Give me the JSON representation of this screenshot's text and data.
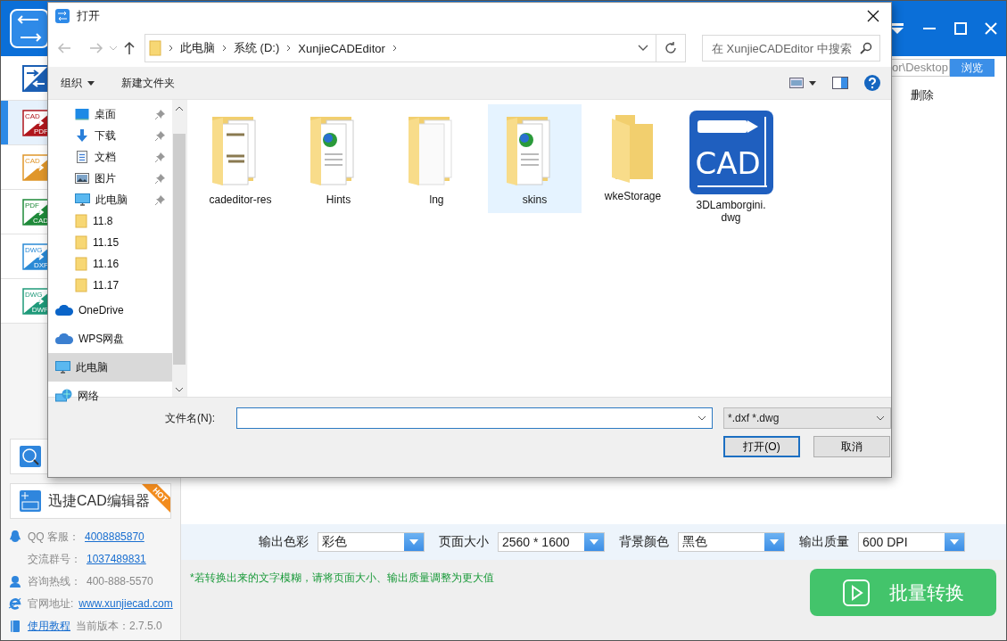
{
  "app": {
    "sidebar": {
      "tools": [
        {
          "kind": "convert",
          "selected": false
        },
        {
          "kind": "cad-pdf",
          "from": "CAD",
          "to": "PDF",
          "selected": true
        },
        {
          "kind": "cad-img",
          "from": "CAD",
          "selected": false
        },
        {
          "kind": "pdf-cad",
          "from": "PDF",
          "to": "CAD",
          "selected": false
        },
        {
          "kind": "dwg-dxf",
          "from": "DWG",
          "to": "DXF",
          "selected": false
        },
        {
          "kind": "dwg-dwf",
          "from": "DWG",
          "to": "DWF",
          "selected": false
        }
      ],
      "editor_button": {
        "label": "迅捷CAD编辑器",
        "badge": "HOT"
      },
      "contacts": [
        {
          "kind": "qq",
          "parts": [
            {
              "text": "QQ 客服：",
              "link": false
            },
            {
              "text": "4008885870",
              "link": true
            }
          ]
        },
        {
          "kind": "group",
          "parts": [
            {
              "text": "交流群号：",
              "link": false
            },
            {
              "text": "1037489831",
              "link": true
            }
          ]
        },
        {
          "kind": "hotline",
          "parts": [
            {
              "text": "咨询热线：",
              "link": false
            },
            {
              "text": "400-888-5570",
              "link": false
            }
          ]
        },
        {
          "kind": "web",
          "parts": [
            {
              "text": "官网地址:",
              "link": false
            },
            {
              "text": "www.xunjiecad.com",
              "link": true
            }
          ]
        },
        {
          "kind": "book",
          "parts": [
            {
              "text": "使用教程",
              "link": true
            },
            {
              "text": "当前版本：2.7.5.0",
              "link": false
            }
          ]
        }
      ]
    },
    "output_path": {
      "value": "or\\Desktop",
      "button": "浏览"
    },
    "toolbar": [
      "删除"
    ],
    "settings": [
      {
        "label": "输出色彩",
        "value": "彩色"
      },
      {
        "label": "页面大小",
        "value": "2560 * 1600"
      },
      {
        "label": "背景颜色",
        "value": "黑色"
      },
      {
        "label": "输出质量",
        "value": "600 DPI"
      }
    ],
    "hint": "*若转换出来的文字模糊，请将页面大小、输出质量调整为更大值",
    "convert_button": "批量转换"
  },
  "dialog": {
    "title": "打开",
    "breadcrumb": [
      "此电脑",
      "系统 (D:)",
      "XunjieCADEditor"
    ],
    "search": {
      "placeholder": "在 XunjieCADEditor 中搜索"
    },
    "toolbar": {
      "organize": "组织",
      "new_folder": "新建文件夹"
    },
    "nav": [
      {
        "kind": "desktop",
        "label": "桌面",
        "pinned": true,
        "selected": false
      },
      {
        "kind": "download",
        "label": "下载",
        "pinned": true,
        "selected": false
      },
      {
        "kind": "document",
        "label": "文档",
        "pinned": true,
        "selected": false
      },
      {
        "kind": "picture",
        "label": "图片",
        "pinned": true,
        "selected": false
      },
      {
        "kind": "pc",
        "label": "此电脑",
        "pinned": true,
        "selected": false
      },
      {
        "kind": "folder",
        "label": "11.8",
        "pinned": false,
        "selected": false
      },
      {
        "kind": "folder",
        "label": "11.15",
        "pinned": false,
        "selected": false
      },
      {
        "kind": "folder",
        "label": "11.16",
        "pinned": false,
        "selected": false
      },
      {
        "kind": "folder",
        "label": "11.17",
        "pinned": false,
        "selected": false
      },
      {
        "kind": "cloud",
        "label": "OneDrive",
        "pinned": false,
        "selected": false
      },
      {
        "kind": "cloud2",
        "label": "WPS网盘",
        "pinned": false,
        "selected": false
      },
      {
        "kind": "pc",
        "label": "此电脑",
        "pinned": false,
        "selected": true
      },
      {
        "kind": "network",
        "label": "网络",
        "pinned": false,
        "selected": false
      }
    ],
    "files": [
      {
        "kind": "folder-docs",
        "name": "cadeditor-res",
        "selected": false
      },
      {
        "kind": "folder-globe",
        "name": "Hints",
        "selected": false
      },
      {
        "kind": "folder-pages",
        "name": "lng",
        "selected": false
      },
      {
        "kind": "folder-globe",
        "name": "skins",
        "selected": true
      },
      {
        "kind": "folder-empty",
        "name": "wkeStorage",
        "selected": false
      },
      {
        "kind": "cad-file",
        "name": "3DLamborgini.dwg",
        "icon_text": "CAD",
        "selected": false
      }
    ],
    "filename": {
      "label": "文件名(N):"
    },
    "filter": "*.dxf *.dwg",
    "buttons": [
      "打开(O)",
      "取消"
    ]
  }
}
